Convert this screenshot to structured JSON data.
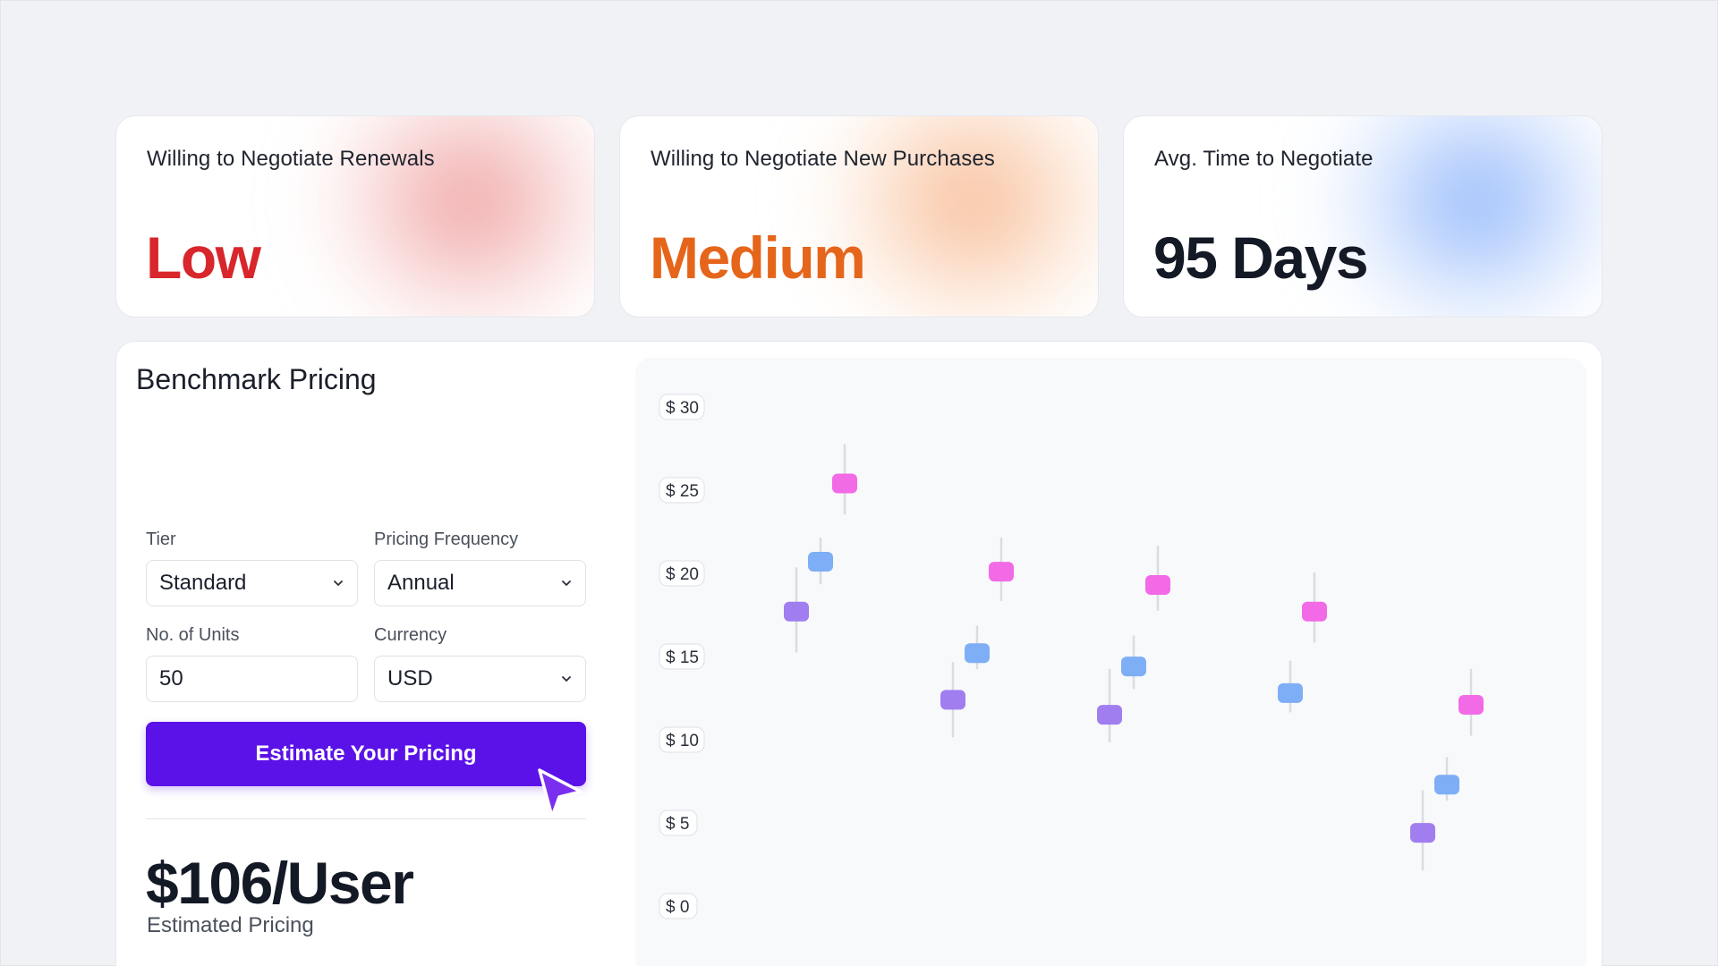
{
  "stats": [
    {
      "label": "Willing to Negotiate Renewals",
      "value": "Low",
      "accent": "#d8262c",
      "glow": "red"
    },
    {
      "label": "Willing to Negotiate New Purchases",
      "value": "Medium",
      "accent": "#e5651b",
      "glow": "orange"
    },
    {
      "label": "Avg. Time to Negotiate",
      "value": "95 Days",
      "accent": "#141926",
      "glow": "blue"
    }
  ],
  "benchmark": {
    "title": "Benchmark Pricing",
    "tier": {
      "label": "Tier",
      "value": "Standard"
    },
    "frequency": {
      "label": "Pricing Frequency",
      "value": "Annual"
    },
    "units": {
      "label": "No. of Units",
      "value": "50"
    },
    "currency": {
      "label": "Currency",
      "value": "USD"
    },
    "cta_label": "Estimate Your Pricing",
    "price": "$106/User",
    "price_caption": "Estimated Pricing"
  },
  "colors": {
    "cta": "#5a12e8",
    "series_purple": "#a07ef0",
    "series_blue": "#7eaef5",
    "series_pink": "#f26ae6",
    "whisker": "#d9dce2"
  },
  "chart_data": {
    "type": "scatter",
    "y_ticks": [
      "$ 0",
      "$ 5",
      "$ 10",
      "$ 15",
      "$ 20",
      "$ 25",
      "$ 30"
    ],
    "ylim": [
      0,
      30
    ],
    "grid": false,
    "groups": [
      {
        "points": [
          {
            "series": "purple",
            "value": 17.7,
            "low": 15.3,
            "high": 20.3
          },
          {
            "series": "blue",
            "value": 20.7,
            "low": 19.4,
            "high": 22.1
          },
          {
            "series": "pink",
            "value": 25.4,
            "low": 23.6,
            "high": 27.7
          }
        ]
      },
      {
        "points": [
          {
            "series": "purple",
            "value": 12.4,
            "low": 10.2,
            "high": 14.6
          },
          {
            "series": "blue",
            "value": 15.2,
            "low": 14.3,
            "high": 16.8
          },
          {
            "series": "pink",
            "value": 20.1,
            "low": 18.4,
            "high": 22.1
          }
        ]
      },
      {
        "points": [
          {
            "series": "purple",
            "value": 11.5,
            "low": 9.9,
            "high": 14.2
          },
          {
            "series": "blue",
            "value": 14.4,
            "low": 13.1,
            "high": 16.2
          },
          {
            "series": "pink",
            "value": 19.3,
            "low": 17.8,
            "high": 21.6
          }
        ]
      },
      {
        "points": [
          {
            "series": "blue",
            "value": 12.8,
            "low": 11.7,
            "high": 14.7
          },
          {
            "series": "pink",
            "value": 17.7,
            "low": 15.9,
            "high": 20.0
          }
        ]
      },
      {
        "points": [
          {
            "series": "purple",
            "value": 4.4,
            "low": 2.2,
            "high": 6.9
          },
          {
            "series": "blue",
            "value": 7.3,
            "low": 6.4,
            "high": 8.9
          },
          {
            "series": "pink",
            "value": 12.1,
            "low": 10.3,
            "high": 14.2
          }
        ]
      }
    ]
  }
}
